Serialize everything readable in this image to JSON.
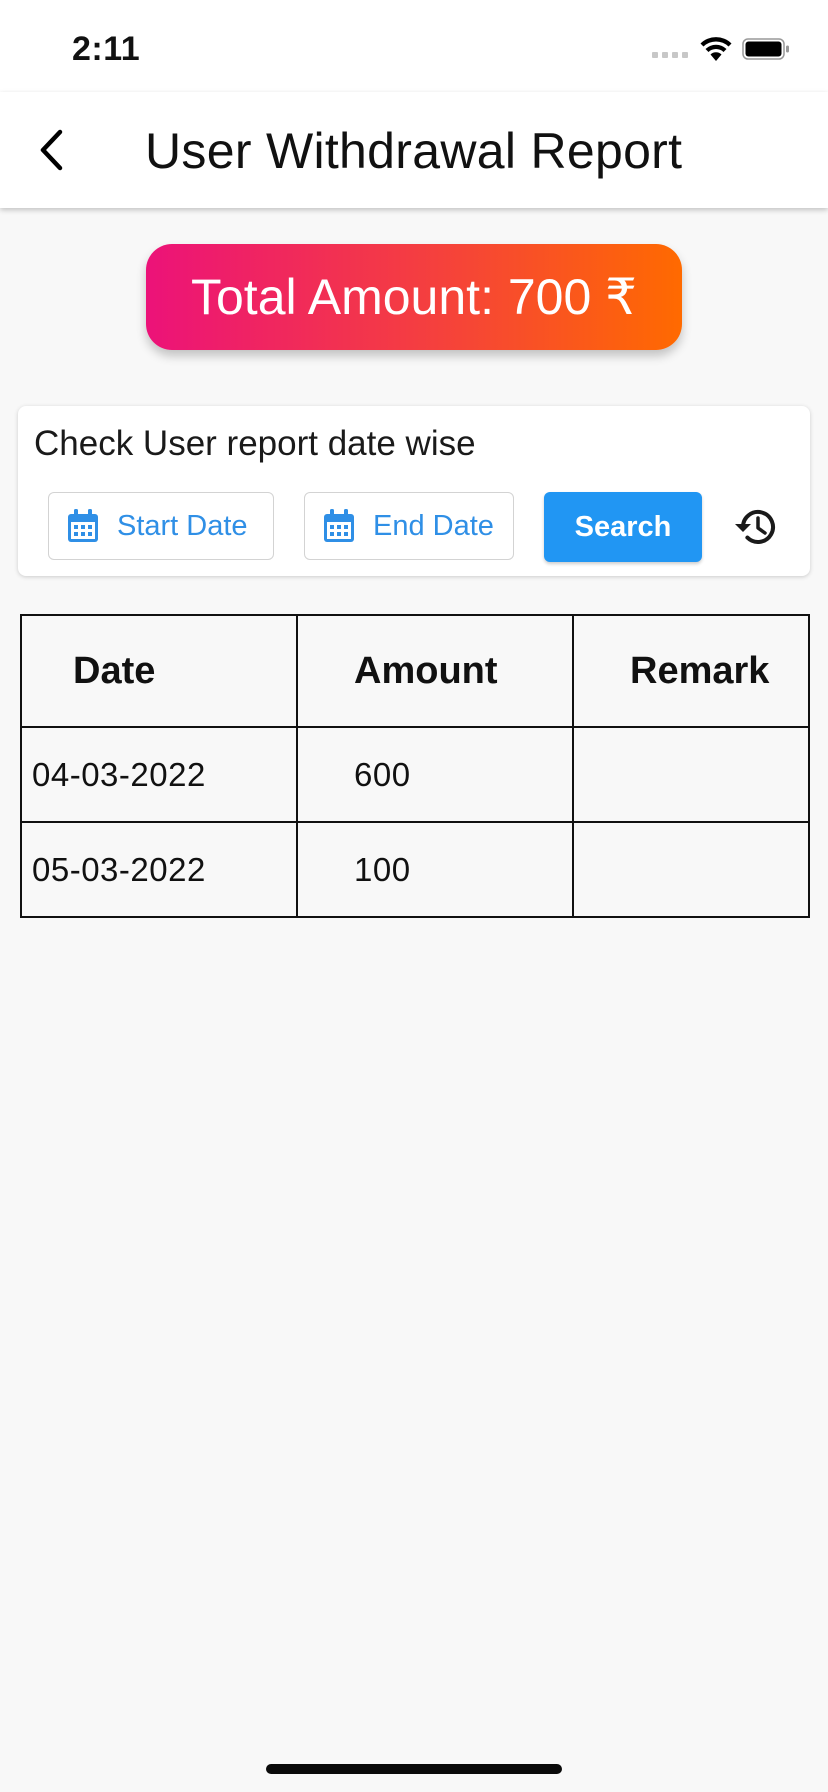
{
  "status_bar": {
    "time": "2:11",
    "icons": [
      "cellular-signal-icon",
      "wifi-icon",
      "battery-icon"
    ]
  },
  "app_bar": {
    "title": "User Withdrawal Report",
    "back_icon": "chevron-left-icon"
  },
  "summary": {
    "total_label": "Total Amount: 700 ₹",
    "gradient_colors": [
      "#ec1279",
      "#ff6a00"
    ]
  },
  "filter": {
    "caption": "Check User report date wise",
    "start_date_label": "Start Date",
    "end_date_label": "End Date",
    "search_label": "Search",
    "date_icon": "calendar-icon",
    "history_icon": "history-icon",
    "accent_color": "#2196f3"
  },
  "table": {
    "headers": [
      "Date",
      "Amount",
      "Remark"
    ],
    "rows": [
      {
        "date": "04-03-2022",
        "amount": "600",
        "remark": ""
      },
      {
        "date": "05-03-2022",
        "amount": "100",
        "remark": ""
      }
    ]
  }
}
